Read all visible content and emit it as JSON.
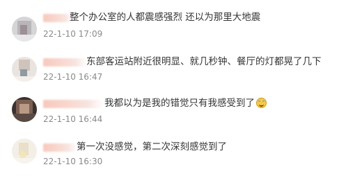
{
  "comments": [
    {
      "text": "整个办公室的人都震感强烈 还以为那里大地震",
      "time": "22-1-10 17:09",
      "avatar_colors": [
        "#d6d4d6",
        "#b9b6ba",
        "#9c8f95",
        "#e7e6e8"
      ]
    },
    {
      "text": "东部客运站附近很明显、就几秒钟、餐厅的灯都晃了几下",
      "time": "22-1-10 16:47",
      "avatar_colors": [
        "#e9e4df",
        "#cfc4bb",
        "#8f9aa4",
        "#f2efec"
      ]
    },
    {
      "text": "我都以为是我的错觉只有我感受到了",
      "emoji": "laughing-tears-emoji",
      "time": "22-1-10 16:44",
      "avatar_colors": [
        "#3a3230",
        "#7b5f52",
        "#b99a86",
        "#5a4a44"
      ]
    },
    {
      "text": "第一次没感觉，第二次深刻感觉到了",
      "time": "22-1-10 16:30",
      "avatar_colors": [
        "#f3efe7",
        "#eadfc9",
        "#f1e6b8",
        "#f7f4ee"
      ]
    }
  ]
}
